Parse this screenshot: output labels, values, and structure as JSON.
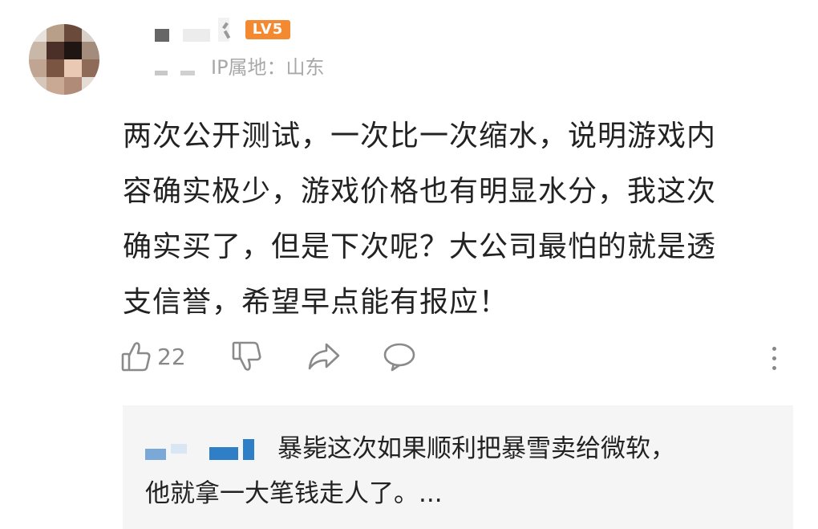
{
  "comment": {
    "level_badge": "LV5",
    "ip_location": "IP属地：山东",
    "body_lines": [
      "两次公开测试，一次比一次缩水，说明游戏内",
      "容确实极少，游戏价格也有明显水分，我这次",
      "确实买了，但是下次呢？大公司最怕的就是透",
      "支信誉，希望早点能有报应！"
    ],
    "like_count": "22"
  },
  "reply": {
    "line1": "暴毙这次如果顺利把暴雪卖给微软，",
    "line2": "他就拿一大笔钱走人了。..."
  },
  "colors": {
    "badge": "#f38a32",
    "text": "#222222",
    "muted": "#a8a8a8",
    "reply_bg": "#f5f5f5",
    "censor_blue": "#2f7fc7"
  },
  "icons": [
    "thumbs-up-icon",
    "thumbs-down-icon",
    "share-icon",
    "reply-bubble-icon",
    "more-vertical-icon"
  ]
}
